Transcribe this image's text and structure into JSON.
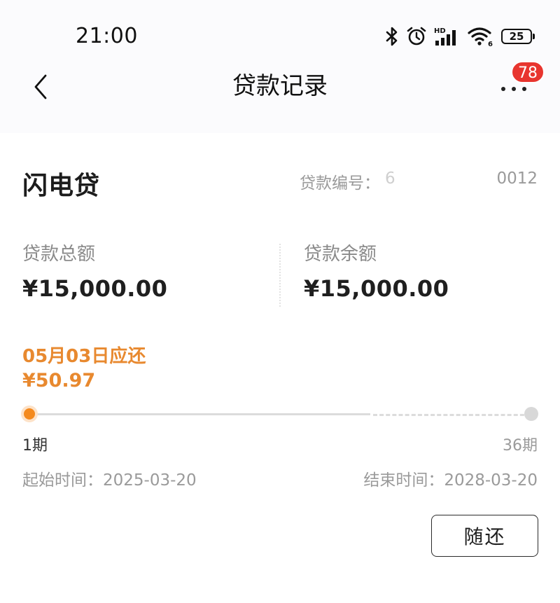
{
  "status_bar": {
    "time": "21:00",
    "network": "HD",
    "wifi_sub": "6",
    "battery": "25",
    "icons": [
      "bluetooth-icon",
      "alarm-icon",
      "signal-icon",
      "wifi-icon",
      "battery-icon"
    ]
  },
  "nav": {
    "title": "贷款记录",
    "badge_count": "78",
    "icons": [
      "back-chevron-icon",
      "more-dots-icon"
    ]
  },
  "loan": {
    "name": "闪电贷",
    "number_label": "贷款编号：",
    "number_head": "6",
    "number_tail": "0012",
    "total_label": "贷款总额",
    "total_value": "¥15,000.00",
    "balance_label": "贷款余额",
    "balance_value": "¥15,000.00"
  },
  "repayment": {
    "due_date": "05月03日应还",
    "due_amount": "¥50.97",
    "current_period": 1,
    "total_periods": 36,
    "period_start_label": "1期",
    "period_end_label": "36期",
    "progress_solid_fraction": 0.68,
    "start_time": "起始时间：2025-03-20",
    "end_time": "结束时间：2028-03-20",
    "button_label": "随还"
  },
  "colors": {
    "accent": "#e8892f",
    "progress_dot": "#f48a1e",
    "badge": "#e8352f"
  }
}
